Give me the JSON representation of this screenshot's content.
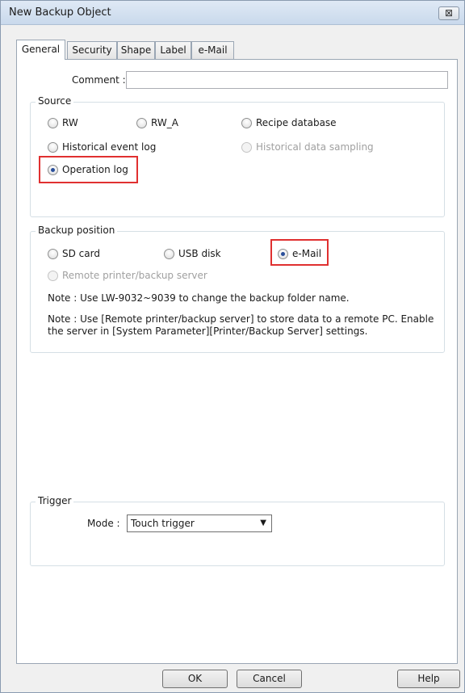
{
  "window": {
    "title": "New Backup Object",
    "close_icon": "close-icon",
    "close_glyph": "⊠"
  },
  "tabs": [
    {
      "label": "General",
      "active": true
    },
    {
      "label": "Security",
      "active": false
    },
    {
      "label": "Shape",
      "active": false
    },
    {
      "label": "Label",
      "active": false
    },
    {
      "label": "e-Mail",
      "active": false
    }
  ],
  "comment": {
    "label": "Comment :",
    "value": ""
  },
  "source": {
    "title": "Source",
    "options": [
      {
        "label": "RW",
        "selected": false,
        "enabled": true
      },
      {
        "label": "RW_A",
        "selected": false,
        "enabled": true
      },
      {
        "label": "Recipe database",
        "selected": false,
        "enabled": true
      },
      {
        "label": "Historical event log",
        "selected": false,
        "enabled": true
      },
      {
        "label": "Historical data sampling",
        "selected": false,
        "enabled": false
      },
      {
        "label": "Operation log",
        "selected": true,
        "enabled": true
      }
    ]
  },
  "backup_position": {
    "title": "Backup position",
    "options": [
      {
        "label": "SD card",
        "selected": false,
        "enabled": true
      },
      {
        "label": "USB disk",
        "selected": false,
        "enabled": true
      },
      {
        "label": "e-Mail",
        "selected": true,
        "enabled": true
      },
      {
        "label": "Remote printer/backup server",
        "selected": false,
        "enabled": false
      }
    ],
    "note1": "Note : Use LW-9032~9039 to change the backup folder name.",
    "note2": "Note : Use [Remote printer/backup server] to store data to a remote PC. Enable the server in [System Parameter][Printer/Backup Server] settings."
  },
  "trigger": {
    "title": "Trigger",
    "mode_label": "Mode :",
    "mode_value": "Touch trigger",
    "mode_arrow": "▼"
  },
  "buttons": {
    "ok": "OK",
    "cancel": "Cancel",
    "help": "Help"
  },
  "colors": {
    "highlight": "#e03030",
    "radio_selected": "#2a4f9a"
  }
}
